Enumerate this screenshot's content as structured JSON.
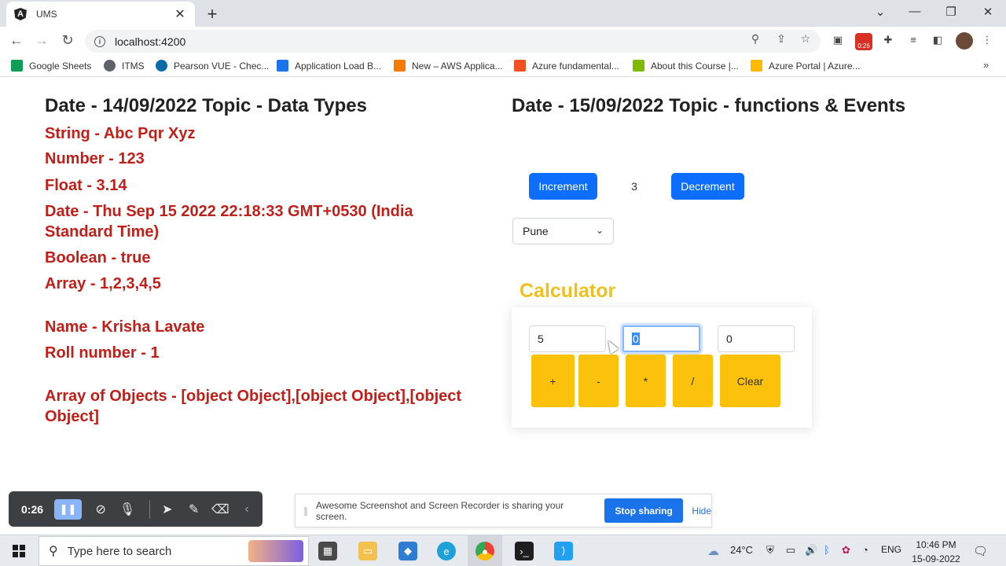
{
  "browser": {
    "tab_title": "UMS",
    "url": "localhost:4200",
    "recording_badge": "0:26",
    "bookmarks": [
      {
        "label": "Google Sheets",
        "color": "#0f9d58"
      },
      {
        "label": "ITMS",
        "color": "#5f6368"
      },
      {
        "label": "Pearson VUE - Chec...",
        "color": "#0b6aa8"
      },
      {
        "label": "Application Load B...",
        "color": "#1a73e8"
      },
      {
        "label": "New – AWS Applica...",
        "color": "#f57c00"
      },
      {
        "label": "Azure fundamental...",
        "color": "#f25022"
      },
      {
        "label": "About this Course |...",
        "color": "#7fba00"
      },
      {
        "label": "Azure Portal | Azure...",
        "color": "#ffb900"
      }
    ]
  },
  "left": {
    "heading": "Date - 14/09/2022 Topic - Data Types",
    "lines": {
      "string": "String - Abc Pqr Xyz",
      "number": "Number - 123",
      "float": "Float - 3.14",
      "date_line1": "Date - Thu Sep 15 2022 22:18:33 GMT+0530 (India",
      "date_line2": "Standard Time)",
      "boolean": "Boolean - true",
      "array": "Array - 1,2,3,4,5",
      "name": "Name - Krisha Lavate",
      "roll": "Roll number - 1",
      "objects_line1": "Array of Objects - [object Object],[object Object],[object",
      "objects_line2": "Object]"
    }
  },
  "right": {
    "heading": "Date - 15/09/2022 Topic - functions & Events",
    "increment_label": "Increment",
    "counter_value": "3",
    "decrement_label": "Decrement",
    "city_selected": "Pune",
    "calculator": {
      "title": "Calculator",
      "input1": "5",
      "input2": "0",
      "result": "0",
      "buttons": [
        "+",
        "-",
        "*",
        "/",
        "Clear"
      ]
    }
  },
  "recorder": {
    "time": "0:26"
  },
  "share_notice": {
    "message": "Awesome Screenshot and Screen Recorder is sharing your screen.",
    "stop_label": "Stop sharing",
    "hide_label": "Hide"
  },
  "taskbar": {
    "search_placeholder": "Type here to search",
    "temperature": "24°C",
    "language": "ENG",
    "time": "10:46 PM",
    "date": "15-09-2022"
  },
  "colors": {
    "red_text": "#c0201a",
    "primary_blue": "#0d6efd",
    "calculator_yellow": "#fcc20b",
    "calculator_title": "#f0c020"
  }
}
